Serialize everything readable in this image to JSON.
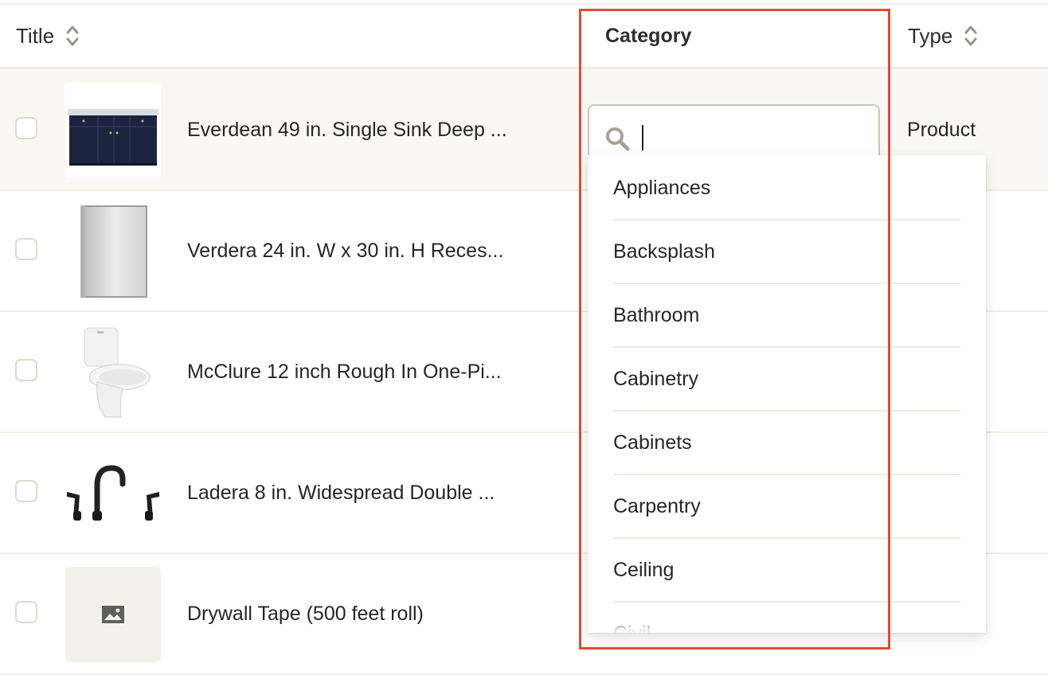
{
  "header": {
    "title": "Title",
    "category": "Category",
    "type": "Type"
  },
  "rows": [
    {
      "title": "Everdean 49 in. Single Sink Deep ...",
      "type": "Product",
      "thumb": "vanity-image"
    },
    {
      "title": "Verdera 24 in. W x 30 in. H Reces...",
      "type": "",
      "thumb": "medicine-cabinet-image"
    },
    {
      "title": "McClure 12 inch Rough In One-Pi...",
      "type": "",
      "thumb": "toilet-image"
    },
    {
      "title": "Ladera 8 in. Widespread Double ...",
      "type": "",
      "thumb": "faucet-image"
    },
    {
      "title": "Drywall Tape (500 feet roll)",
      "type": "",
      "thumb": "image-placeholder-icon"
    }
  ],
  "category_search": {
    "value": "",
    "icon": "search-icon"
  },
  "category_options": [
    "Appliances",
    "Backsplash",
    "Bathroom",
    "Cabinetry",
    "Cabinets",
    "Carpentry",
    "Ceiling",
    "Civil"
  ],
  "colors": {
    "highlight": "#e24a31",
    "row_selected_bg": "#f9f8f4",
    "divider": "#eeece4"
  }
}
